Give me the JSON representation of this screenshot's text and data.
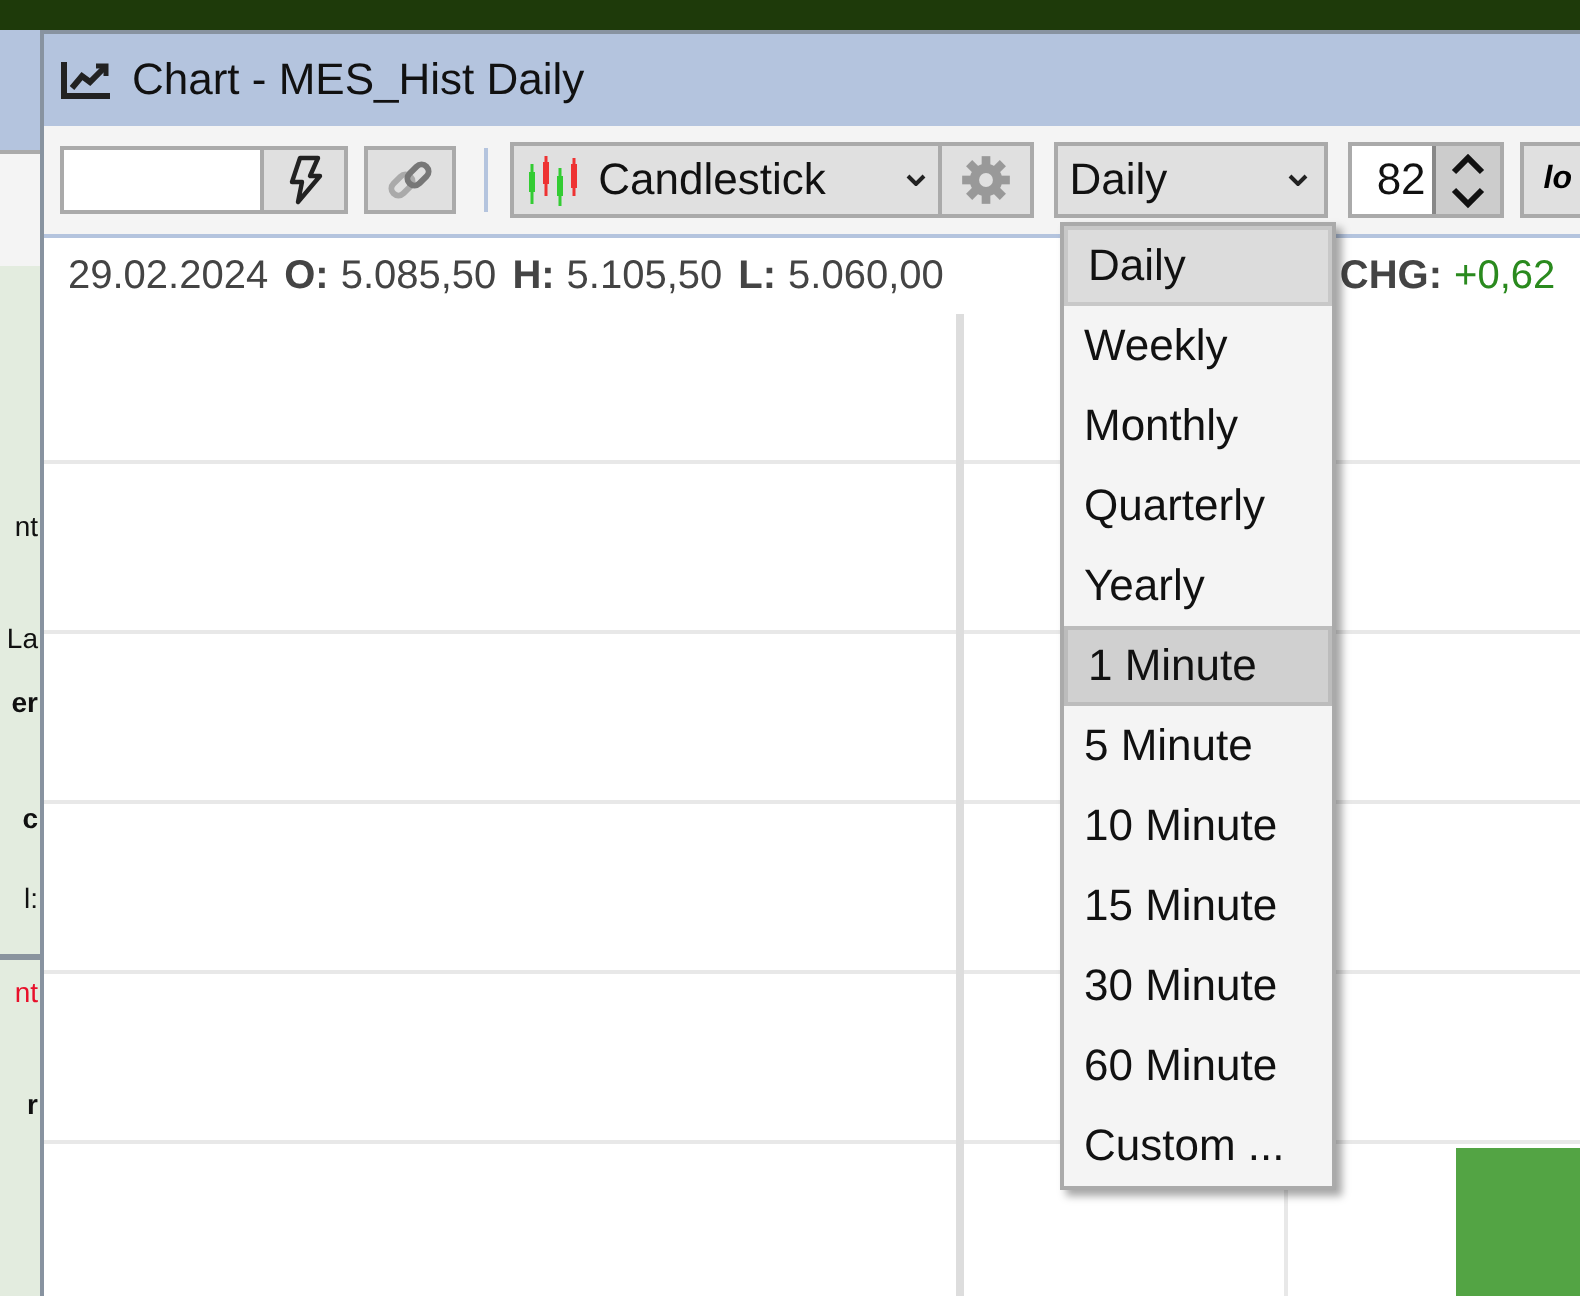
{
  "background_panel": {
    "fragments": [
      {
        "text": "nt",
        "kind": "normal"
      },
      {
        "text": "La",
        "kind": "normal"
      },
      {
        "text": "er",
        "kind": "bold"
      },
      {
        "text": "c",
        "kind": "bold"
      },
      {
        "text": "l:",
        "kind": "normal"
      },
      {
        "text": "nt",
        "kind": "alert"
      },
      {
        "text": "r",
        "kind": "bold"
      }
    ]
  },
  "window": {
    "title": "Chart - MES_Hist Daily"
  },
  "toolbar": {
    "chart_type": "Candlestick",
    "interval": "Daily",
    "bar_count": "82",
    "cut_button": "lo"
  },
  "info_line": {
    "date": "29.02.2024",
    "fields": [
      {
        "label": "O:",
        "value": "5.085,50",
        "kind": "plain"
      },
      {
        "label": "H:",
        "value": "5.105,50",
        "kind": "plain"
      },
      {
        "label": "L:",
        "value": "5.060,00",
        "kind": "plain"
      },
      {
        "label": "CHG:",
        "value": "+0,62",
        "kind": "up"
      }
    ]
  },
  "interval_menu": {
    "items": [
      {
        "label": "Daily",
        "selected": true,
        "hovered": false
      },
      {
        "label": "Weekly",
        "selected": false,
        "hovered": false
      },
      {
        "label": "Monthly",
        "selected": false,
        "hovered": false
      },
      {
        "label": "Quarterly",
        "selected": false,
        "hovered": false
      },
      {
        "label": "Yearly",
        "selected": false,
        "hovered": false
      },
      {
        "label": "1 Minute",
        "selected": false,
        "hovered": true
      },
      {
        "label": "5 Minute",
        "selected": false,
        "hovered": false
      },
      {
        "label": "10 Minute",
        "selected": false,
        "hovered": false
      },
      {
        "label": "15 Minute",
        "selected": false,
        "hovered": false
      },
      {
        "label": "30 Minute",
        "selected": false,
        "hovered": false
      },
      {
        "label": "60 Minute",
        "selected": false,
        "hovered": false
      },
      {
        "label": "Custom ...",
        "selected": false,
        "hovered": false
      }
    ]
  }
}
